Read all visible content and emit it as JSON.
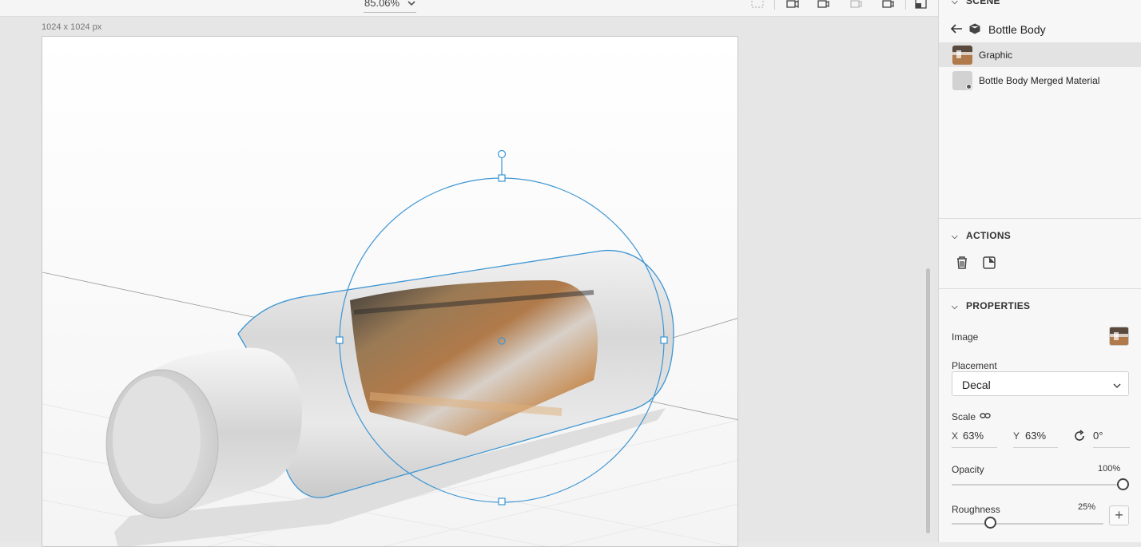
{
  "toolbar": {
    "zoom_value": "85.06%",
    "tools": [
      "frame-icon",
      "camera-add-icon",
      "camera-move-icon",
      "camera-disabled-icon",
      "camera-icon",
      "panel-icon"
    ]
  },
  "canvas": {
    "dimensions_label": "1024 x 1024 px",
    "accent": "#3d96d3"
  },
  "panel": {
    "scene_header": "SCENE",
    "breadcrumb": "Bottle Body",
    "layers": [
      {
        "label": "Graphic",
        "selected": true
      },
      {
        "label": "Bottle Body Merged Material",
        "selected": false
      }
    ],
    "actions_header": "ACTIONS",
    "actions": [
      "trash-icon",
      "edit-decal-icon"
    ],
    "properties_header": "PROPERTIES",
    "image_label": "Image",
    "placement_label": "Placement",
    "placement_value": "Decal",
    "scale_label": "Scale",
    "scale_x_axis": "X",
    "scale_x": "63%",
    "scale_y_axis": "Y",
    "scale_y": "63%",
    "rotation": "0°",
    "opacity_label": "Opacity",
    "opacity_value": "100%",
    "opacity_level": 1.0,
    "roughness_label": "Roughness",
    "roughness_value": "25%",
    "roughness_level": 0.25
  }
}
